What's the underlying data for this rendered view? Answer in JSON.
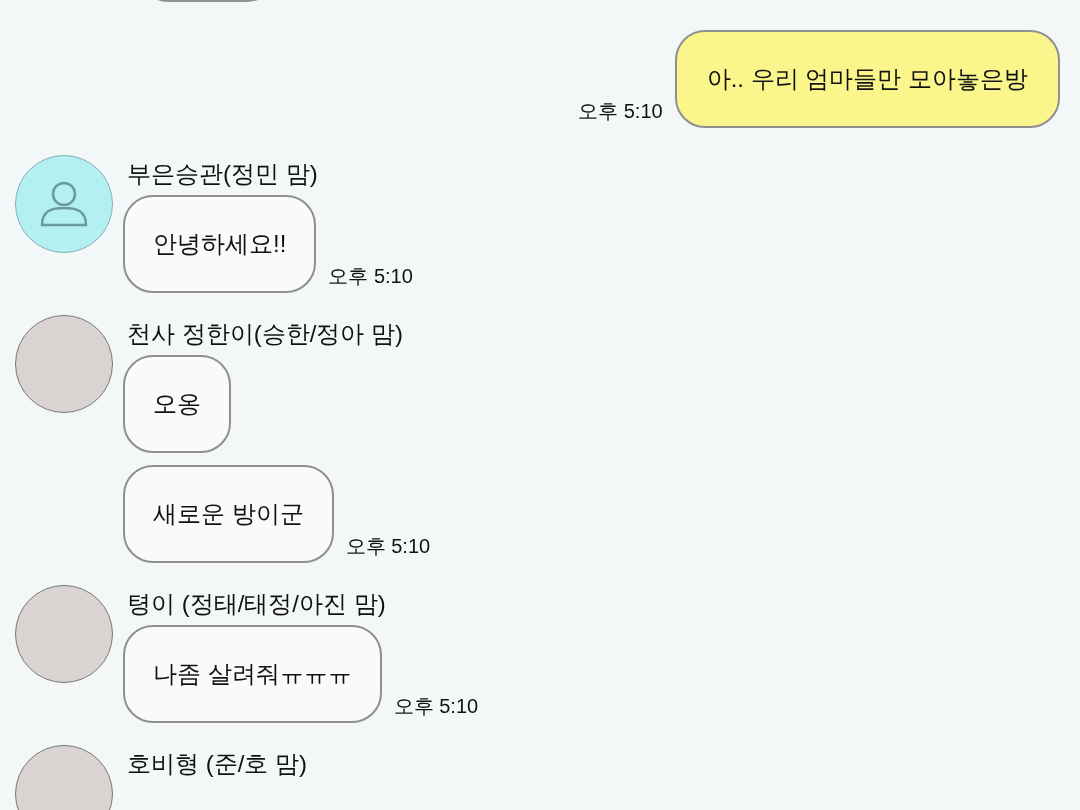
{
  "messages": [
    {
      "kind": "sent",
      "text": "아.. 우리 엄마들만 모아놓은방",
      "time": "오후 5:10"
    },
    {
      "kind": "received",
      "sender": "부은승관(정민 맘)",
      "avatar": {
        "kind": "default"
      },
      "bubbles": [
        {
          "text": "안녕하세요!!",
          "time": "오후 5:10"
        }
      ]
    },
    {
      "kind": "received",
      "sender": "천사 정한이(승한/정아 맘)",
      "avatar": {
        "kind": "photo"
      },
      "bubbles": [
        {
          "text": "오옹"
        },
        {
          "text": "새로운 방이군",
          "time": "오후 5:10"
        }
      ]
    },
    {
      "kind": "received",
      "sender": "텽이 (정태/태정/아진 맘)",
      "avatar": {
        "kind": "photo"
      },
      "bubbles": [
        {
          "text": "나좀 살려줘ㅠㅠㅠ",
          "time": "오후 5:10"
        }
      ]
    },
    {
      "kind": "received",
      "sender": "호비형 (준/호 맘)",
      "avatar": {
        "kind": "photo"
      }
    }
  ]
}
